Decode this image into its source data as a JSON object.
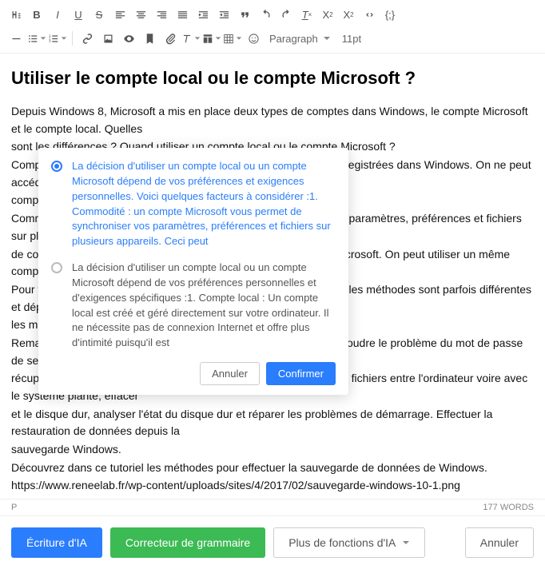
{
  "toolbar": {
    "paragraph_label": "Paragraph",
    "fontsize_label": "11pt"
  },
  "document": {
    "title": "Utiliser le compte local ou le compte Microsoft ?",
    "body_lines": [
      "Depuis Windows 8, Microsoft a mis en place deux types de comptes dans Windows, le compte Microsoft et le compte local. Quelles",
      "sont les différences ? Quand utiliser un compte local ou le compte Microsoft ?",
      "Compte local. Les informations de connexion de ce compte sont enregistrées dans Windows. On ne peut accéder qu'à un seul",
      "compte local sur un ordinateur.",
      "Commodité : un compte Microsoft vous permet de synchroniser vos paramètres, préférences et fichiers sur plusieurs appareils.",
      "de compte, vous pouvez enregistrer ce compte sur le serveur de Microsoft. On peut utiliser un même compte Microsoft sur plusieurs",
      "Pour trouver le mot de passe de session Windows sur Windows 10, les méthodes sont parfois différentes et dépendent de",
      "les méthodes pour trouver le mot de passe.",
      "Remarque : Avec Renee PassNow, vous pouvez non seulement résoudre le problème du mot de passe de session Windows oublié, mais aussi",
      "récupérer les fichiers supprimés, cloner le disque dur, transférer des fichiers entre l'ordinateur voire avec le système planté, effacer",
      "et le disque dur, analyser l'état du disque dur et réparer les problèmes de démarrage. Effectuer la restauration de données depuis la",
      "sauvegarde Windows.",
      "Découvrez dans ce tutoriel les méthodes pour effectuer la sauvegarde de données de Windows.",
      "https://www.reneelab.fr/wp-content/uploads/sites/4/2017/02/sauvegarde-windows-10-1.png"
    ]
  },
  "popup": {
    "option_a": "La décision d'utiliser un compte local ou un compte Microsoft dépend de vos préférences et exigences personnelles. Voici quelques facteurs à considérer :1. Commodité : un compte Microsoft vous permet de synchroniser vos paramètres, préférences et fichiers sur plusieurs appareils. Ceci peut",
    "option_b": "La décision d'utiliser un compte local ou un compte Microsoft dépend de vos préférences personnelles et d'exigences spécifiques :1. Compte local : Un compte local est créé et géré directement sur votre ordinateur. Il ne nécessite pas de connexion Internet et offre plus d'intimité puisqu'il est",
    "cancel": "Annuler",
    "confirm": "Confirmer"
  },
  "status": {
    "path": "P",
    "words": "177 WORDS"
  },
  "bottom": {
    "ai_write": "Écriture d'IA",
    "grammar": "Correcteur de grammaire",
    "more_ai": "Plus de fonctions d'IA",
    "cancel": "Annuler"
  }
}
